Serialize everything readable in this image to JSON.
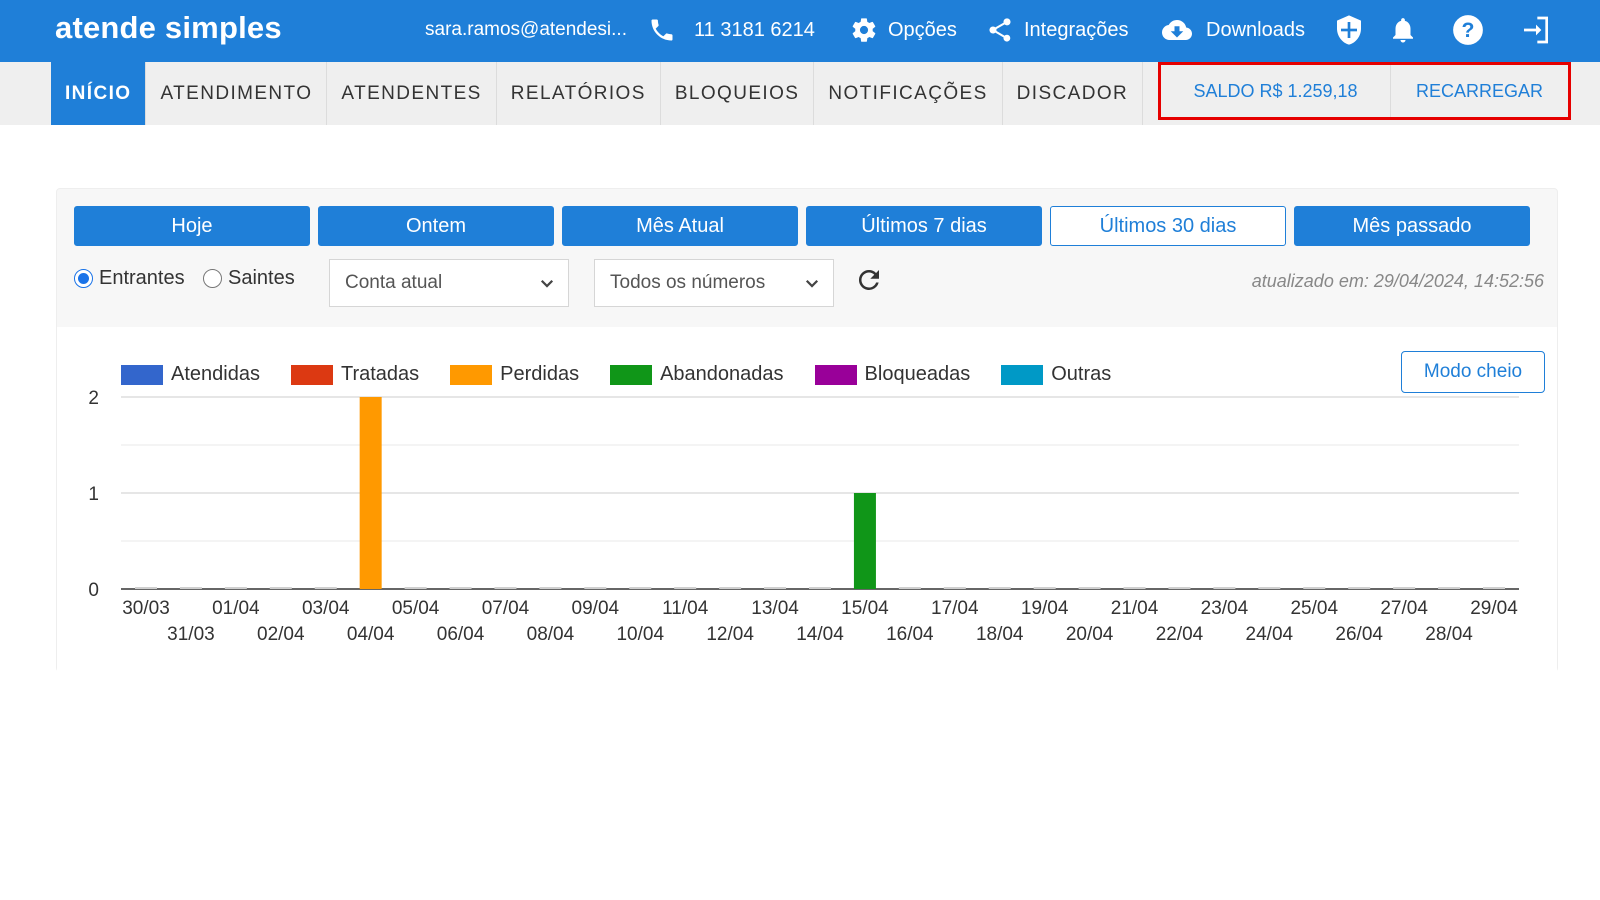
{
  "topbar": {
    "logo": "atende simples",
    "email": "sara.ramos@atendesi...",
    "phone": "11 3181 6214",
    "options_label": "Opções",
    "integrations_label": "Integrações",
    "downloads_label": "Downloads",
    "icons": [
      "phone-icon",
      "gear-icon",
      "share-icon",
      "cloud-download-icon",
      "shield-icon",
      "bell-icon",
      "help-icon",
      "logout-icon"
    ]
  },
  "nav": {
    "tabs": [
      {
        "label": "INÍCIO",
        "active": true
      },
      {
        "label": "ATENDIMENTO"
      },
      {
        "label": "ATENDENTES"
      },
      {
        "label": "RELATÓRIOS"
      },
      {
        "label": "BLOQUEIOS"
      },
      {
        "label": "NOTIFICAÇÕES"
      },
      {
        "label": "DISCADOR"
      }
    ],
    "saldo": "SALDO R$ 1.259,18",
    "recarregar": "RECARREGAR"
  },
  "periods": {
    "items": [
      "Hoje",
      "Ontem",
      "Mês Atual",
      "Últimos 7 dias",
      "Últimos 30 dias",
      "Mês passado"
    ],
    "selected": "Últimos 30 dias"
  },
  "filters": {
    "incoming": "Entrantes",
    "outgoing": "Saintes",
    "direction_selected": "Entrantes",
    "account_select": "Conta atual",
    "numbers_select": "Todos os números",
    "updated": "atualizado em: 29/04/2024, 14:52:56"
  },
  "modo_cheio": "Modo cheio",
  "colors": {
    "primary": "#1f7fd8",
    "highlight": "#e60000",
    "atendidas": "#3366cc",
    "tratadas": "#dc3912",
    "perdidas": "#ff9900",
    "abandonadas": "#109618",
    "bloqueadas": "#990099",
    "outras": "#0099c6"
  },
  "chart_data": {
    "type": "bar",
    "stacked": true,
    "categories": [
      "30/03",
      "31/03",
      "01/04",
      "02/04",
      "03/04",
      "04/04",
      "05/04",
      "06/04",
      "07/04",
      "08/04",
      "09/04",
      "10/04",
      "11/04",
      "12/04",
      "13/04",
      "14/04",
      "15/04",
      "16/04",
      "17/04",
      "18/04",
      "19/04",
      "20/04",
      "21/04",
      "22/04",
      "23/04",
      "24/04",
      "25/04",
      "26/04",
      "27/04",
      "28/04",
      "29/04"
    ],
    "series": [
      {
        "name": "Atendidas",
        "color": "#3366cc",
        "values": [
          0,
          0,
          0,
          0,
          0,
          0,
          0,
          0,
          0,
          0,
          0,
          0,
          0,
          0,
          0,
          0,
          0,
          0,
          0,
          0,
          0,
          0,
          0,
          0,
          0,
          0,
          0,
          0,
          0,
          0,
          0
        ]
      },
      {
        "name": "Tratadas",
        "color": "#dc3912",
        "values": [
          0,
          0,
          0,
          0,
          0,
          0,
          0,
          0,
          0,
          0,
          0,
          0,
          0,
          0,
          0,
          0,
          0,
          0,
          0,
          0,
          0,
          0,
          0,
          0,
          0,
          0,
          0,
          0,
          0,
          0,
          0
        ]
      },
      {
        "name": "Perdidas",
        "color": "#ff9900",
        "values": [
          0,
          0,
          0,
          0,
          0,
          2,
          0,
          0,
          0,
          0,
          0,
          0,
          0,
          0,
          0,
          0,
          0,
          0,
          0,
          0,
          0,
          0,
          0,
          0,
          0,
          0,
          0,
          0,
          0,
          0,
          0
        ]
      },
      {
        "name": "Abandonadas",
        "color": "#109618",
        "values": [
          0,
          0,
          0,
          0,
          0,
          0,
          0,
          0,
          0,
          0,
          0,
          0,
          0,
          0,
          0,
          0,
          1,
          0,
          0,
          0,
          0,
          0,
          0,
          0,
          0,
          0,
          0,
          0,
          0,
          0,
          0
        ]
      },
      {
        "name": "Bloqueadas",
        "color": "#990099",
        "values": [
          0,
          0,
          0,
          0,
          0,
          0,
          0,
          0,
          0,
          0,
          0,
          0,
          0,
          0,
          0,
          0,
          0,
          0,
          0,
          0,
          0,
          0,
          0,
          0,
          0,
          0,
          0,
          0,
          0,
          0,
          0
        ]
      },
      {
        "name": "Outras",
        "color": "#0099c6",
        "values": [
          0,
          0,
          0,
          0,
          0,
          0,
          0,
          0,
          0,
          0,
          0,
          0,
          0,
          0,
          0,
          0,
          0,
          0,
          0,
          0,
          0,
          0,
          0,
          0,
          0,
          0,
          0,
          0,
          0,
          0,
          0
        ]
      }
    ],
    "y_ticks": [
      "0",
      "1",
      "2"
    ],
    "ylim": [
      0,
      2
    ],
    "grid": true,
    "legend": "top-left"
  }
}
